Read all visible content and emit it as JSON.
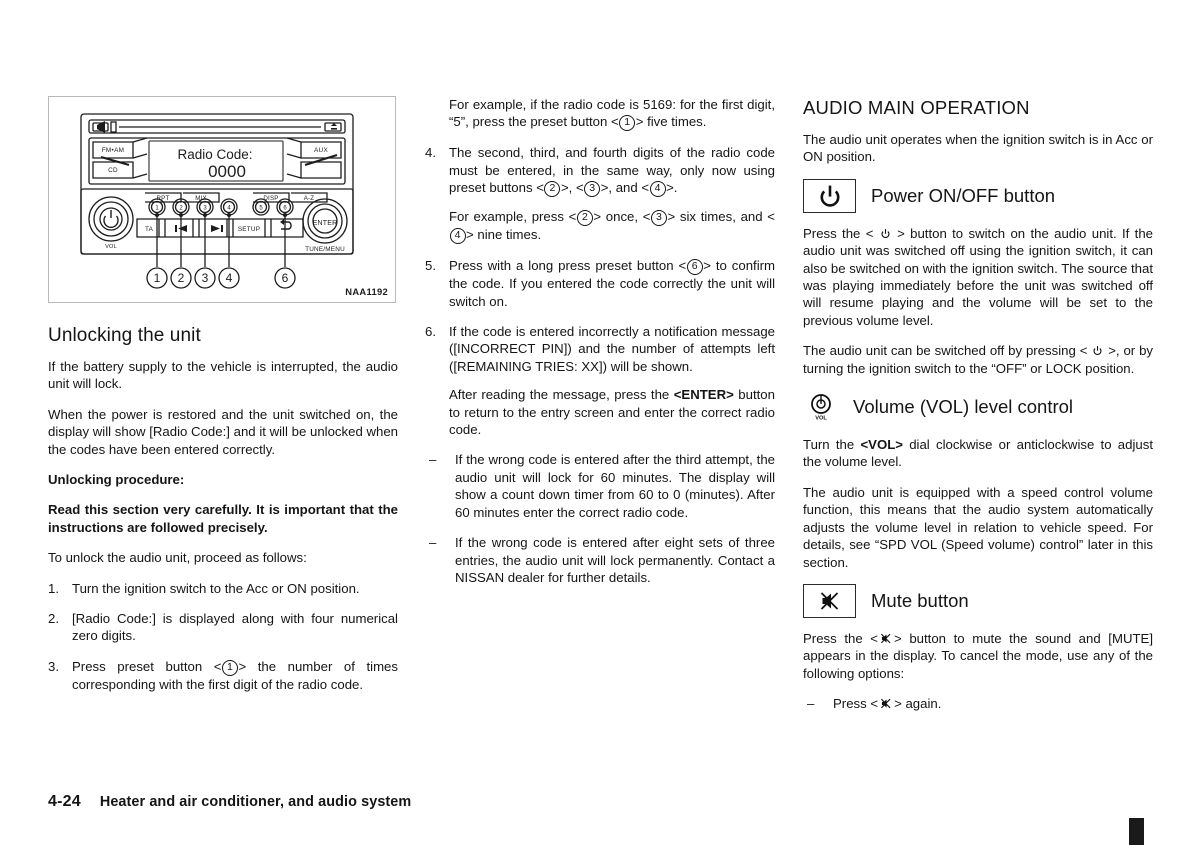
{
  "document": {
    "page_number": "4-24",
    "footer_section": "Heater and air conditioner, and audio system"
  },
  "figure": {
    "code": "NAA1192",
    "display_label": "Radio Code:",
    "display_value": "0000",
    "buttons": {
      "left_top": "FM•AM",
      "left_bottom": "CD",
      "right_top": "AUX",
      "enter": "ENTER",
      "tune_menu": "TUNE/MENU",
      "vol": "VOL",
      "ta": "TA",
      "setup": "SETUP"
    },
    "preset_top_labels": [
      "RPT",
      "MIX",
      "",
      "",
      "DISP",
      "A-Z"
    ],
    "preset_numbers": [
      "1",
      "2",
      "3",
      "4",
      "5",
      "6"
    ],
    "callouts": [
      "1",
      "2",
      "3",
      "4",
      "6"
    ]
  },
  "col1": {
    "heading": "Unlocking the unit",
    "p1": "If the battery supply to the vehicle is interrupted, the audio unit will lock.",
    "p2": "When the power is restored and the unit switched on, the display will show [Radio Code:] and it will be unlocked when the codes have been entered correctly.",
    "subheading": "Unlocking procedure:",
    "warning": "Read this section very carefully. It is important that the instructions are followed precisely.",
    "p3": "To unlock the audio unit, proceed as follows:",
    "steps": [
      {
        "marker": "1.",
        "text": "Turn the ignition switch to the Acc or ON position."
      },
      {
        "marker": "2.",
        "text": "[Radio Code:] is displayed along with four numerical zero digits."
      },
      {
        "marker": "3.",
        "pre": "Press preset button <",
        "circled": "1",
        "post": "> the number of times corresponding with the first digit of the radio code."
      }
    ]
  },
  "col2": {
    "example1_pre": "For example, if the radio code is 5169: for the first digit, “5”, press the preset button <",
    "example1_circled": "1",
    "example1_post": "> five times.",
    "step4": {
      "marker": "4.",
      "part_a": "The second, third, and fourth digits of the radio code must be entered, in the same way, only now using preset buttons <",
      "c1": "2",
      "part_b": ">, <",
      "c2": "3",
      "part_c": ">, and <",
      "c3": "4",
      "part_d": ">."
    },
    "example2": {
      "pre": "For example, press <",
      "c1": "2",
      "mid1": "> once, <",
      "c2": "3",
      "mid2": "> six times, and <",
      "c3": "4",
      "post": "> nine times."
    },
    "step5": {
      "marker": "5.",
      "pre": "Press with a long press preset button <",
      "circled": "6",
      "post": "> to confirm the code. If you entered the code correctly the unit will switch on."
    },
    "step6": {
      "marker": "6.",
      "text": "If the code is entered incorrectly a notification message ([INCORRECT PIN]) and the number of attempts left ([REMAINING TRIES: XX]) will be shown."
    },
    "after_msg_pre": "After reading the message, press the ",
    "after_msg_bold": "<ENTER>",
    "after_msg_post": " button to return to the entry screen and enter the correct radio code.",
    "bullets": [
      {
        "marker": "–",
        "text": "If the wrong code is entered after the third attempt, the audio unit will lock for 60 minutes. The display will show a count down timer from 60 to 0 (minutes). After 60 minutes enter the correct radio code."
      },
      {
        "marker": "–",
        "text": "If the wrong code is entered after eight sets of three entries, the audio unit will lock permanently. Contact a NISSAN dealer for further details."
      }
    ]
  },
  "col3": {
    "heading": "AUDIO MAIN OPERATION",
    "intro": "The audio unit operates when the ignition switch is in Acc or ON position.",
    "power_heading": "Power ON/OFF button",
    "power_p1_pre": "Press the < ",
    "power_p1_post": " > button to switch on the audio unit. If the audio unit was switched off using the ignition switch, it can also be switched on with the ignition switch. The source that was playing immediately before the unit was switched off will resume playing and the volume will be set to the previous volume level.",
    "power_p2_pre": "The audio unit can be switched off by pressing < ",
    "power_p2_post": " >, or by turning the ignition switch to the “OFF” or LOCK position.",
    "vol_heading": "Volume (VOL) level control",
    "vol_icon_label": "VOL",
    "vol_p1_pre": "Turn the ",
    "vol_p1_bold": "<VOL>",
    "vol_p1_post": " dial clockwise or anticlockwise to adjust the volume level.",
    "vol_p2": "The audio unit is equipped with a speed control volume function, this means that the audio system automatically adjusts the volume level in relation to vehicle speed. For details, see “SPD VOL (Speed volume) control” later in this section.",
    "mute_heading": "Mute button",
    "mute_p1_pre": "Press the <",
    "mute_p1_post": "> button to mute the sound and [MUTE] appears in the display. To cancel the mode, use any of the following options:",
    "mute_bullet": {
      "marker": "–",
      "pre": "Press <",
      "post": "> again."
    }
  },
  "colors": {
    "text": "#151515",
    "figure_border": "#b9b9b9",
    "edge_tab": "#1a1a1a"
  }
}
